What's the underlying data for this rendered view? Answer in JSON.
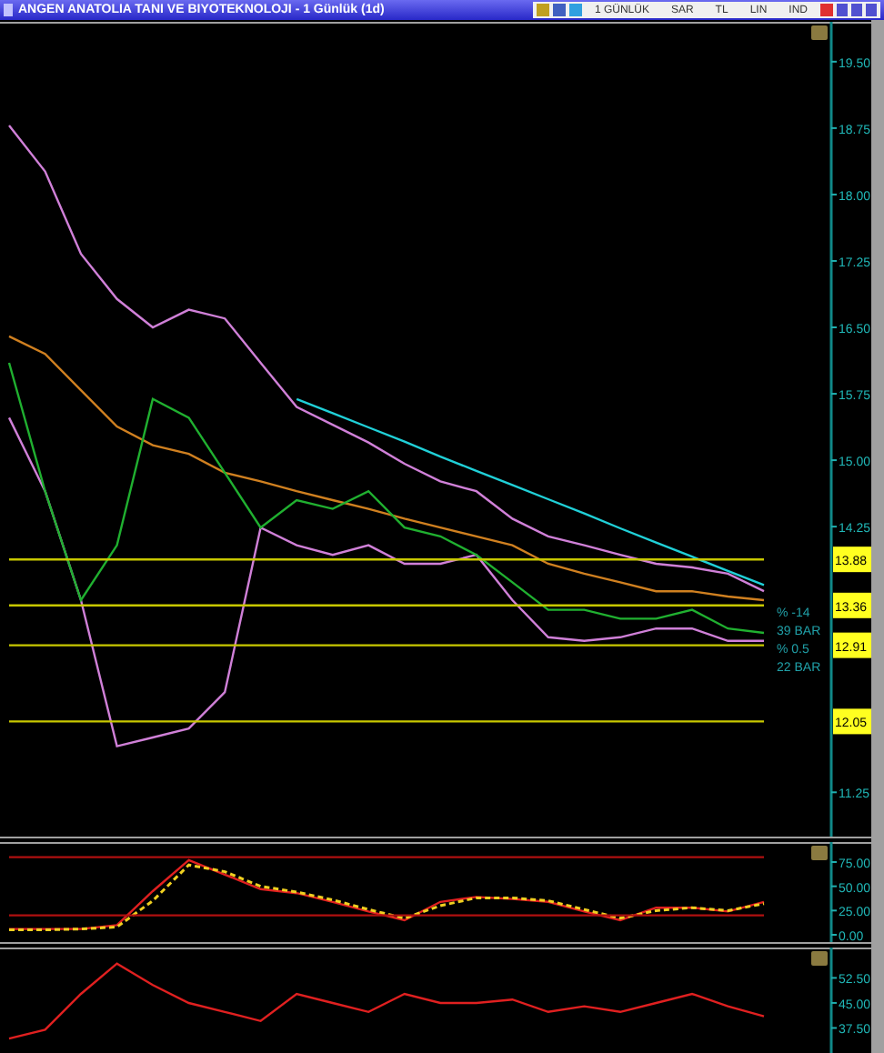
{
  "window": {
    "title": "ANGEN ANATOLIA TANI VE BIYOTEKNOLOJI - 1 Günlük (1d)"
  },
  "toolbar": {
    "labels": [
      "1 GÜNLÜK",
      "SAR",
      "TL",
      "LIN",
      "IND"
    ]
  },
  "price_panel": {
    "notes": [
      "% -14",
      "39 BAR",
      "% 0.5",
      "22 BAR"
    ],
    "chart_data": {
      "type": "line",
      "ylim": [
        10.75,
        19.95
      ],
      "yticks": [
        {
          "value": 19.5,
          "label": "19.50"
        },
        {
          "value": 18.75,
          "label": "18.75"
        },
        {
          "value": 18,
          "label": "18.00"
        },
        {
          "value": 17.25,
          "label": "17.25"
        },
        {
          "value": 16.5,
          "label": "16.50"
        },
        {
          "value": 15.75,
          "label": "15.75"
        },
        {
          "value": 15,
          "label": "15.00"
        },
        {
          "value": 14.25,
          "label": "14.25"
        },
        {
          "value": 13.88,
          "label": "13.88"
        },
        {
          "value": 13.36,
          "label": "13.36"
        },
        {
          "value": 12.91,
          "label": "12.91"
        },
        {
          "value": 12.05,
          "label": "12.05"
        },
        {
          "value": 11.25,
          "label": "11.25"
        }
      ],
      "series": [
        {
          "color": "#d080d8",
          "values": [
            18.78,
            18.26,
            17.33,
            16.82,
            16.5,
            16.7,
            16.6,
            16.1,
            15.6,
            15.4,
            15.2,
            14.96,
            14.76,
            14.65,
            14.34,
            14.14,
            14.04,
            13.93,
            13.83,
            13.79,
            13.72,
            13.52
          ]
        },
        {
          "color": "#d080d8",
          "values": [
            15.48,
            14.65,
            13.42,
            11.77,
            11.87,
            11.97,
            12.38,
            14.24,
            14.04,
            13.93,
            14.04,
            13.83,
            13.83,
            13.93,
            13.42,
            13.0,
            12.96,
            13.0,
            13.1,
            13.1,
            12.96,
            12.96
          ]
        },
        {
          "color": "#d08020",
          "values": [
            16.4,
            16.2,
            15.79,
            15.38,
            15.17,
            15.07,
            14.86,
            14.76,
            14.65,
            14.55,
            14.45,
            14.34,
            14.24,
            14.14,
            14.04,
            13.83,
            13.72,
            13.62,
            13.52,
            13.52,
            13.46,
            13.42
          ]
        },
        {
          "color": "#20b030",
          "values": [
            16.1,
            14.65,
            13.42,
            14.04,
            15.69,
            15.48,
            14.86,
            14.24,
            14.55,
            14.45,
            14.65,
            14.24,
            14.14,
            13.93,
            13.62,
            13.31,
            13.31,
            13.21,
            13.21,
            13.31,
            13.1,
            13.05
          ]
        },
        {
          "color": "#20d0d8",
          "values": [
            null,
            null,
            null,
            null,
            null,
            null,
            null,
            null,
            15.69,
            15.53,
            15.37,
            15.21,
            15.04,
            14.88,
            14.72,
            14.56,
            14.4,
            14.23,
            14.07,
            13.91,
            13.75,
            13.59
          ]
        },
        {
          "color": "#c8c800",
          "values": [
            13.88,
            13.88,
            13.88,
            13.88,
            13.88,
            13.88,
            13.88,
            13.88,
            13.88,
            13.88,
            13.88,
            13.88,
            13.88,
            13.88,
            13.88,
            13.88,
            13.88,
            13.88,
            13.88,
            13.88,
            13.88,
            13.88
          ]
        },
        {
          "color": "#c8c800",
          "values": [
            13.36,
            13.36,
            13.36,
            13.36,
            13.36,
            13.36,
            13.36,
            13.36,
            13.36,
            13.36,
            13.36,
            13.36,
            13.36,
            13.36,
            13.36,
            13.36,
            13.36,
            13.36,
            13.36,
            13.36,
            13.36,
            13.36
          ]
        },
        {
          "color": "#c8c800",
          "values": [
            12.91,
            12.91,
            12.91,
            12.91,
            12.91,
            12.91,
            12.91,
            12.91,
            12.91,
            12.91,
            12.91,
            12.91,
            12.91,
            12.91,
            12.91,
            12.91,
            12.91,
            12.91,
            12.91,
            12.91,
            12.91,
            12.91
          ]
        },
        {
          "color": "#c8c800",
          "values": [
            12.05,
            12.05,
            12.05,
            12.05,
            12.05,
            12.05,
            12.05,
            12.05,
            12.05,
            12.05,
            12.05,
            12.05,
            12.05,
            12.05,
            12.05,
            12.05,
            12.05,
            12.05,
            12.05,
            12.05,
            12.05,
            12.05
          ]
        }
      ]
    }
  },
  "oscillator_panel": {
    "chart_data": {
      "type": "line",
      "ylim": [
        -7.5,
        95.6
      ],
      "yticks": [
        {
          "value": 75,
          "label": "75.00"
        },
        {
          "value": 50,
          "label": "50.00"
        },
        {
          "value": 25,
          "label": "25.00"
        },
        {
          "value": 0,
          "label": "0.00"
        }
      ],
      "series": [
        {
          "color": "#e02020",
          "values": [
            6,
            6,
            6,
            10,
            45,
            77,
            62,
            47,
            43,
            34,
            24,
            15,
            34,
            39,
            37,
            34,
            24,
            15,
            28,
            28,
            24,
            34
          ]
        },
        {
          "color": "#f0d020",
          "line_style": "dashed",
          "values": [
            5,
            5,
            6,
            8,
            35,
            72,
            65,
            50,
            44,
            36,
            26,
            17,
            30,
            38,
            38,
            35,
            26,
            17,
            25,
            28,
            25,
            32
          ]
        },
        {
          "color": "#b01010",
          "values": [
            80,
            80,
            80,
            80,
            80,
            80,
            80,
            80,
            80,
            80,
            80,
            80,
            80,
            80,
            80,
            80,
            80,
            80,
            80,
            80,
            80,
            80
          ]
        },
        {
          "color": "#b01010",
          "values": [
            20,
            20,
            20,
            20,
            20,
            20,
            20,
            20,
            20,
            20,
            20,
            20,
            20,
            20,
            20,
            20,
            20,
            20,
            20,
            20,
            20,
            20
          ]
        }
      ]
    }
  },
  "momentum_panel": {
    "chart_data": {
      "type": "line",
      "ylim": [
        30,
        61.6
      ],
      "yticks": [
        {
          "value": 52.5,
          "label": "52.50"
        },
        {
          "value": 45,
          "label": "45.00"
        },
        {
          "value": 37.5,
          "label": "37.50"
        }
      ],
      "series": [
        {
          "color": "#e02020",
          "values": [
            34.3,
            37,
            47.7,
            56.8,
            50.4,
            45,
            42.3,
            39.6,
            47.7,
            45,
            42.3,
            47.7,
            45,
            45,
            46,
            42.3,
            44,
            42.3,
            45,
            47.7,
            44,
            41
          ]
        }
      ]
    }
  }
}
